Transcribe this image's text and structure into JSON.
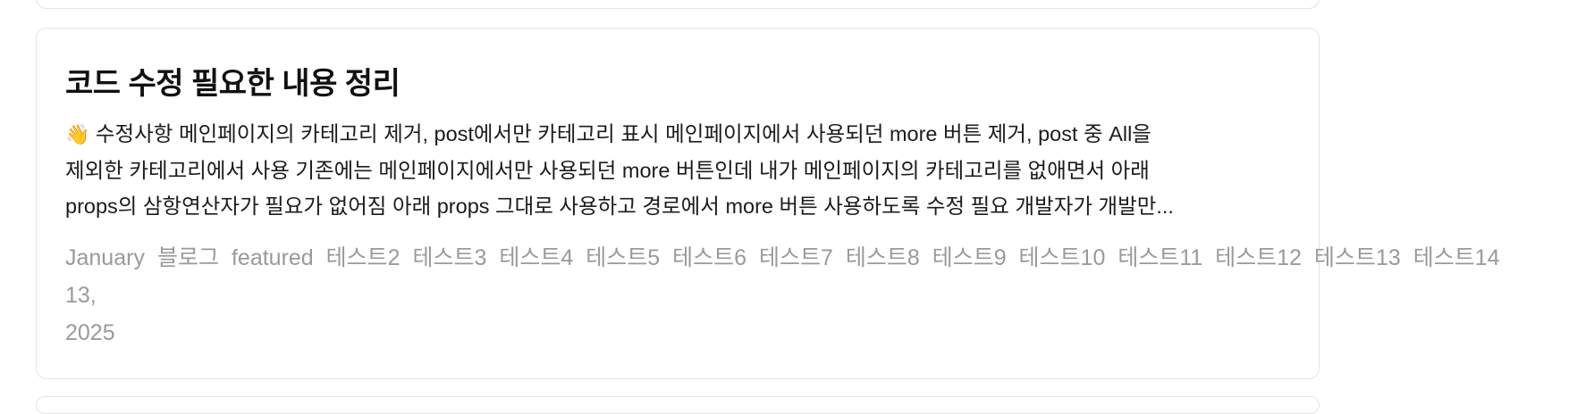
{
  "post": {
    "title": "코드 수정 필요한 내용 정리",
    "excerpt_emoji": "👋",
    "excerpt_lines": [
      " 수정사항 메인페이지의 카테고리 제거, post에서만 카테고리 표시 메인페이지에서 사용되던 more 버튼 제거, post 중 All을",
      "제외한 카테고리에서 사용 기존에는 메인페이지에서만 사용되던 more 버튼인데 내가 메인페이지의 카테고리를 없애면서 아래",
      "props의 삼항연산자가 필요가 없어짐 아래 props 그대로 사용하고 경로에서 more 버튼 사용하도록 수정 필요 개발자가 개발만..."
    ],
    "date_parts": [
      "January",
      "13,",
      "2025"
    ],
    "tags": [
      "블로그",
      "featured",
      "테스트2",
      "테스트3",
      "테스트4",
      "테스트5",
      "테스트6",
      "테스트7",
      "테스트8",
      "테스트9",
      "테스트10",
      "테스트11",
      "테스트12",
      "테스트13",
      "테스트14"
    ]
  }
}
